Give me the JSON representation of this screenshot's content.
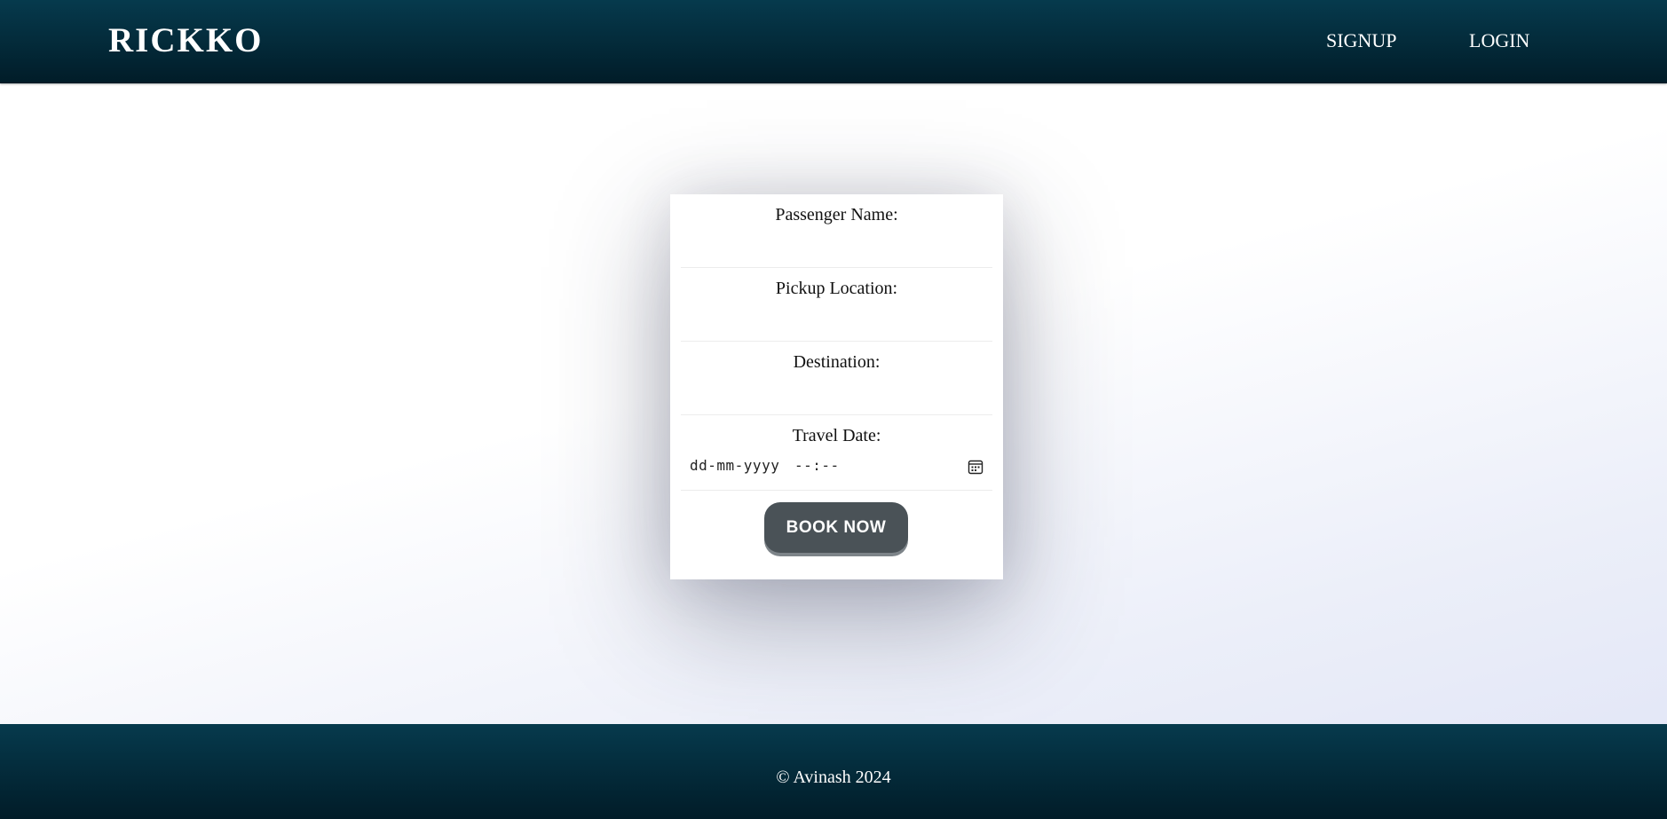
{
  "header": {
    "logo": "RICKKO",
    "nav": {
      "signup": "SIGNUP",
      "login": "LOGIN"
    }
  },
  "form": {
    "fields": [
      {
        "label": "Passenger Name:",
        "value": ""
      },
      {
        "label": "Pickup Location:",
        "value": ""
      },
      {
        "label": "Destination:",
        "value": ""
      },
      {
        "label": "Travel Date:",
        "date_placeholder": "dd-mm-yyyy",
        "time_placeholder": "--:--"
      }
    ],
    "submit_label": "BOOK NOW"
  },
  "icons": {
    "calendar": "calendar-icon"
  },
  "colors": {
    "header_bg": "#063a4d",
    "button_bg": "#4a5257"
  },
  "footer": {
    "copyright": "© Avinash 2024"
  }
}
